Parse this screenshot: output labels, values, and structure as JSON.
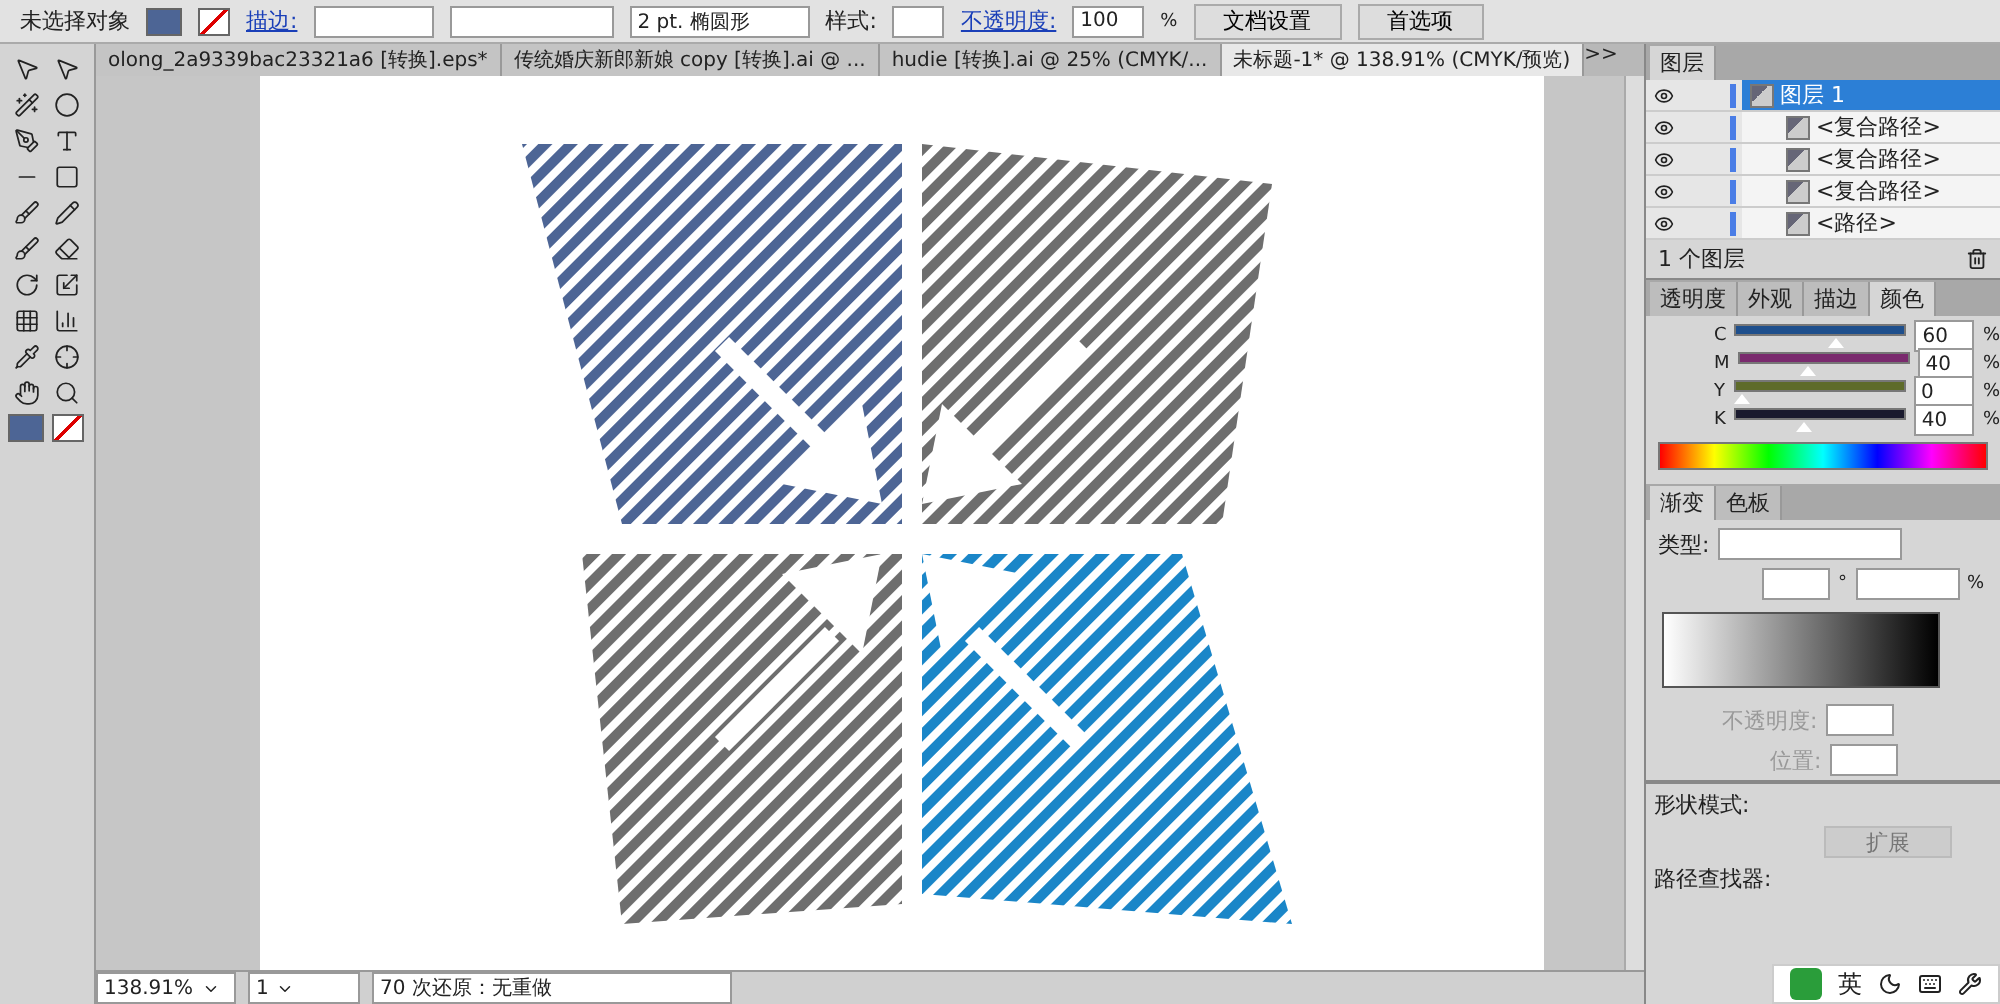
{
  "control_bar": {
    "selection": "未选择对象",
    "stroke_label": "描边:",
    "brush": "2 pt. 椭圆形",
    "style_label": "样式:",
    "opacity_label": "不透明度:",
    "opacity": "100",
    "percent": "%",
    "buttons": [
      "文档设置",
      "首选项"
    ]
  },
  "doc_tabs": [
    {
      "label": "olong_2a9339bac23321a6 [转换].eps*",
      "selected": false
    },
    {
      "label": "传统婚庆新郎新娘 copy [转换].ai @ ...",
      "selected": false
    },
    {
      "label": "hudie [转换].ai @ 25% (CMYK/...",
      "selected": false
    },
    {
      "label": "未标题-1* @ 138.91% (CMYK/预览)",
      "selected": true
    }
  ],
  "overflow": ">>",
  "layers_panel": {
    "title": "图层",
    "layers": [
      {
        "name": "图层 1",
        "selected": true,
        "children": [
          {
            "name": "<复合路径>",
            "selected": false
          },
          {
            "name": "<复合路径>",
            "selected": false
          },
          {
            "name": "<复合路径>",
            "selected": false
          },
          {
            "name": "<路径>",
            "selected": false
          }
        ]
      }
    ],
    "count": "1 个图层"
  },
  "color_panel": {
    "tabs": [
      {
        "label": "透明度",
        "selected": false
      },
      {
        "label": "外观",
        "selected": false
      },
      {
        "label": "描边",
        "selected": false
      },
      {
        "label": "颜色",
        "selected": true
      }
    ],
    "sliders": [
      {
        "label": "C",
        "level": 0.6,
        "value": "60",
        "color": "#1e4f8c"
      },
      {
        "label": "M",
        "level": 0.4,
        "value": "40",
        "color": "#7a2a6e"
      },
      {
        "label": "Y",
        "level": 0,
        "value": "0",
        "color": "#5e6b2a"
      },
      {
        "label": "K",
        "level": 0.4,
        "value": "40",
        "color": "#1a1a2e"
      }
    ],
    "percent": "%"
  },
  "gradient_panel": {
    "tabs": [
      {
        "label": "渐变",
        "selected": true
      },
      {
        "label": "色板",
        "selected": false
      }
    ],
    "type_label": "类型:",
    "degree": "°",
    "percent": "%",
    "opacity_label": "不透明度:",
    "position_label": "位置:"
  },
  "pathfinder_panel": {
    "shape_modes_label": "形状模式:",
    "expand": "扩展",
    "pathfinder_label": "路径查找器:"
  },
  "status_bar": {
    "zoom": "138.91%",
    "page": "1",
    "status": "70 次还原：无重做"
  },
  "ime": {
    "label": "英"
  }
}
